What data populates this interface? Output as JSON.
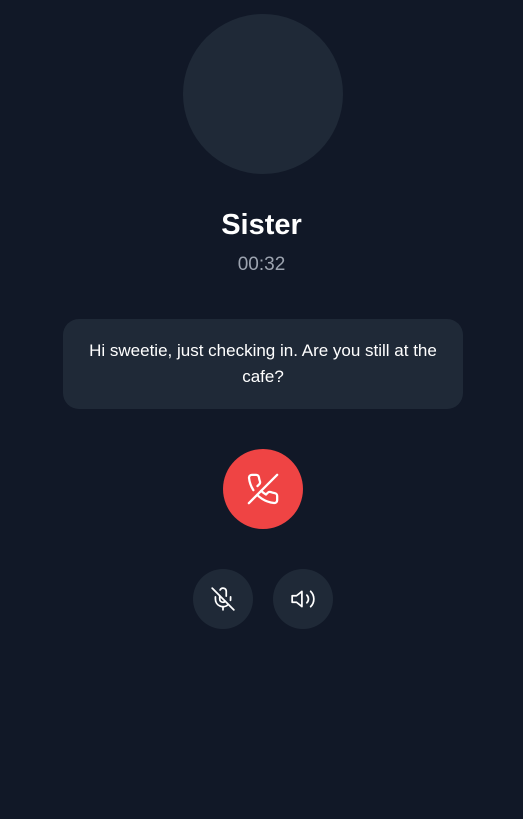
{
  "caller": {
    "name": "Sister",
    "timer": "00:32"
  },
  "message": {
    "text": "Hi sweetie, just checking in. Are you still at the cafe?"
  },
  "controls": {
    "end_call_icon": "phone-off-icon",
    "mute_icon": "mic-off-icon",
    "speaker_icon": "volume-icon"
  },
  "colors": {
    "background": "#111827",
    "surface": "#1f2937",
    "end_call": "#ef4444",
    "muted_text": "#9ca3af"
  }
}
